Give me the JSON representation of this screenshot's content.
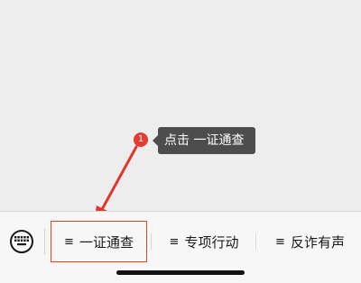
{
  "tooltip": {
    "step_number": "1",
    "text": "点击 一证通查"
  },
  "bottom_menu": {
    "items": [
      {
        "label": "一证通查",
        "icon": "menu-lines-icon",
        "highlighted": true
      },
      {
        "label": "专项行动",
        "icon": "menu-lines-icon",
        "highlighted": false
      },
      {
        "label": "反诈有声",
        "icon": "menu-lines-icon",
        "highlighted": false
      }
    ],
    "menu_glyph": "≡",
    "keyboard_icon": "keyboard-icon"
  },
  "colors": {
    "highlight_border": "#d9481f",
    "arrow": "#e0362c",
    "badge": "#e63b30",
    "tooltip_bg": "#4d4d4d"
  }
}
